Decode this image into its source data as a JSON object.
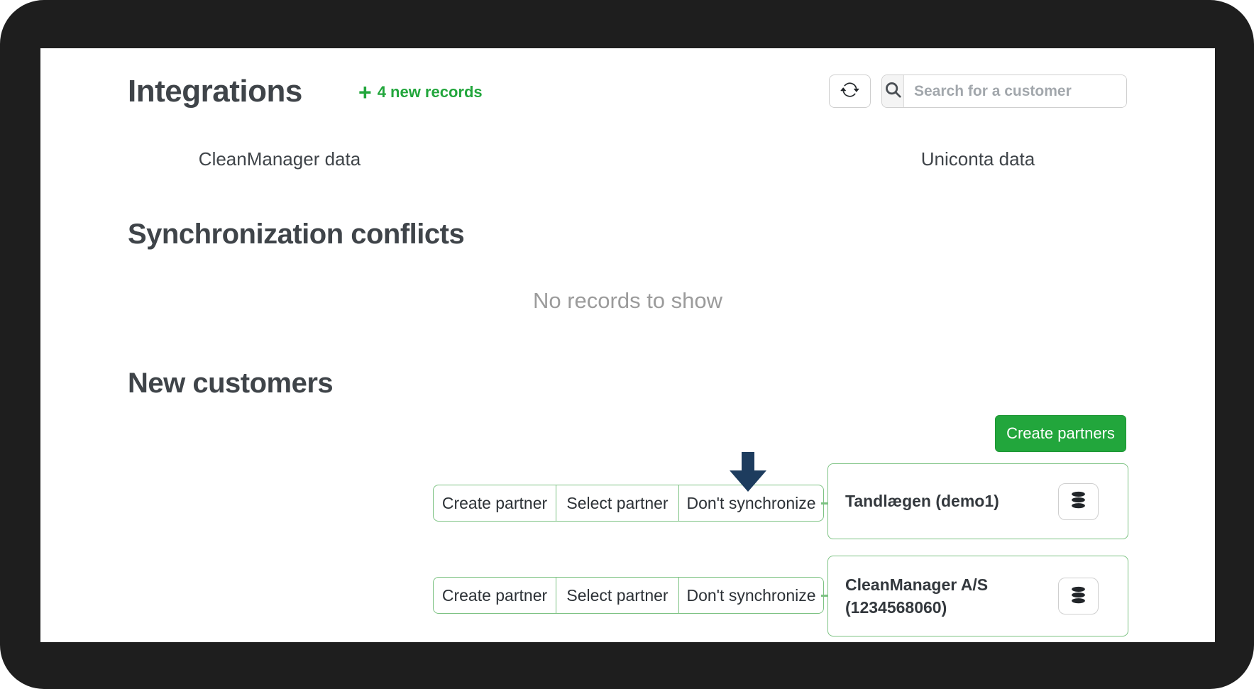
{
  "header": {
    "title": "Integrations",
    "new_records": {
      "plus": "+",
      "label": "4 new records"
    },
    "search": {
      "placeholder": "Search for a customer"
    }
  },
  "columns": {
    "left_label": "CleanManager data",
    "right_label": "Uniconta data"
  },
  "conflicts_section": {
    "title": "Synchronization conflicts",
    "empty_message": "No records to show"
  },
  "new_customers_section": {
    "title": "New customers",
    "create_partners_label": "Create partners"
  },
  "rows": [
    {
      "actions": {
        "create": "Create partner",
        "select": "Select partner",
        "dont_sync": "Don't synchronize"
      },
      "customer_name": "Tandlægen (demo1)"
    },
    {
      "actions": {
        "create": "Create partner",
        "select": "Select partner",
        "dont_sync": "Don't synchronize"
      },
      "customer_name": "CleanManager A/S (1234568060)"
    }
  ],
  "icons": {
    "refresh": "refresh-icon",
    "search": "search-icon",
    "arrow": "arrow-down-icon",
    "database": "database-icon"
  },
  "colors": {
    "accent_green": "#22a63c",
    "border_green": "#7cc282",
    "arrow_navy": "#1d3c5e",
    "frame_black": "#1e1e1e",
    "heading_text": "#3f4449",
    "muted_text": "#9b9b9b"
  }
}
